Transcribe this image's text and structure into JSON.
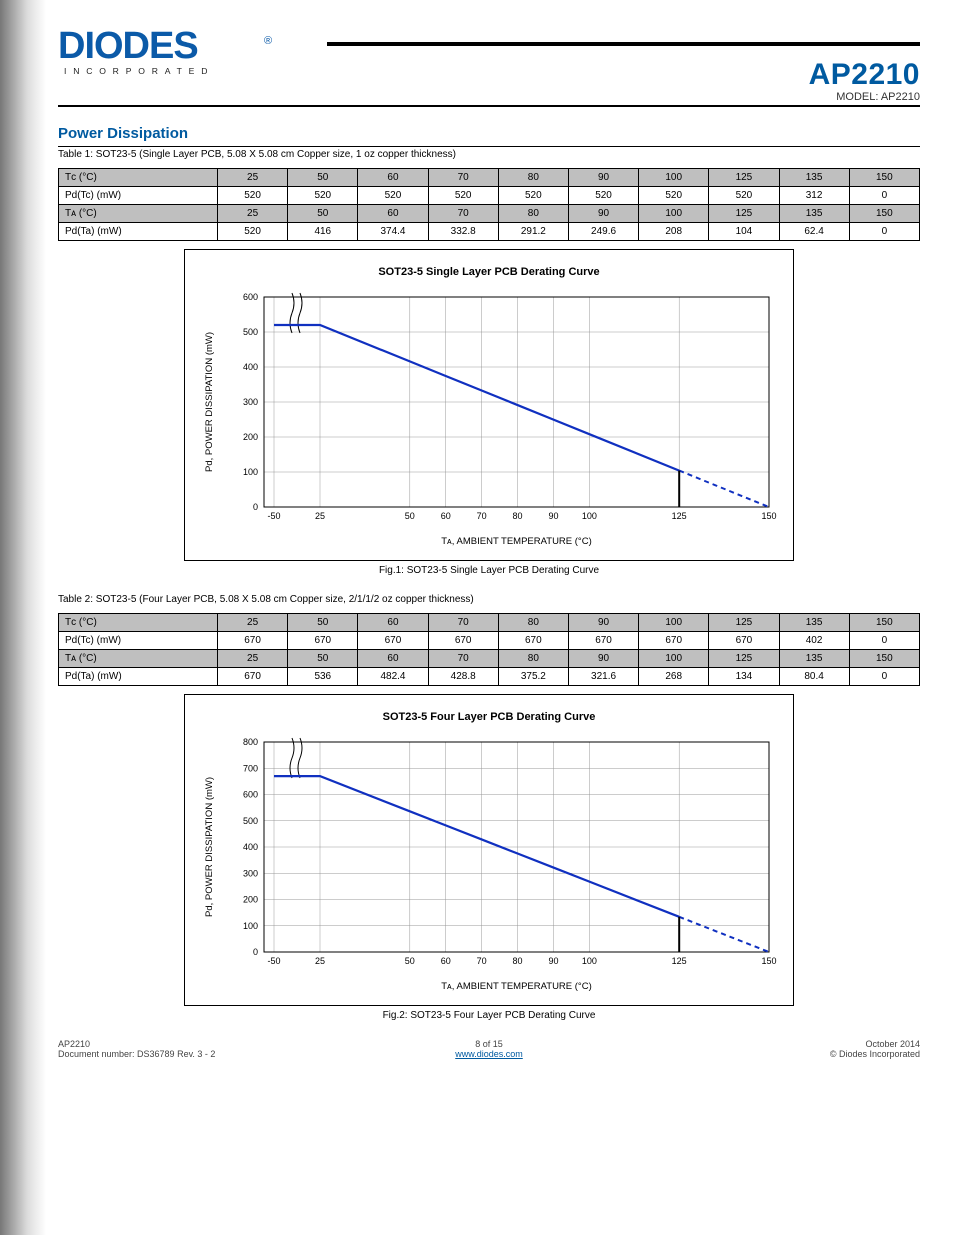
{
  "header": {
    "part_number": "AP2210",
    "model_line": "MODEL: AP2210"
  },
  "sections": {
    "power_title": "Power Dissipation",
    "section1": {
      "subnote": "Table 1: SOT23-5 (Single Layer PCB, 5.08 X 5.08 cm Copper size, 1 oz copper thickness)",
      "table": {
        "tc_row_label": "Tᴄ (°C)",
        "tc_values": [
          "25",
          "50",
          "60",
          "70",
          "80",
          "90",
          "100",
          "125",
          "135",
          "150"
        ],
        "pd_tc_row_label": "Pd(Tc) (mW)",
        "pd_tc_values": [
          "520",
          "520",
          "520",
          "520",
          "520",
          "520",
          "520",
          "520",
          "312",
          "0"
        ],
        "ta_row_label": "Tᴀ (°C)",
        "ta_values": [
          "25",
          "50",
          "60",
          "70",
          "80",
          "90",
          "100",
          "125",
          "135",
          "150"
        ],
        "pd_ta_row_label": "Pd(Ta) (mW)",
        "pd_ta_values": [
          "520",
          "416",
          "374.4",
          "332.8",
          "291.2",
          "249.6",
          "208",
          "104",
          "62.4",
          "0"
        ]
      },
      "chart_caption": "Fig.1: SOT23-5 Single Layer PCB Derating Curve"
    },
    "section2": {
      "subnote": "Table 2: SOT23-5 (Four Layer PCB, 5.08 X 5.08 cm Copper size, 2/1/1/2 oz copper thickness)",
      "table": {
        "tc_row_label": "Tᴄ (°C)",
        "tc_values": [
          "25",
          "50",
          "60",
          "70",
          "80",
          "90",
          "100",
          "125",
          "135",
          "150"
        ],
        "pd_tc_row_label": "Pd(Tc) (mW)",
        "pd_tc_values": [
          "670",
          "670",
          "670",
          "670",
          "670",
          "670",
          "670",
          "670",
          "402",
          "0"
        ],
        "ta_row_label": "Tᴀ (°C)",
        "ta_values": [
          "25",
          "50",
          "60",
          "70",
          "80",
          "90",
          "100",
          "125",
          "135",
          "150"
        ],
        "pd_ta_row_label": "Pd(Ta) (mW)",
        "pd_ta_values": [
          "670",
          "536",
          "482.4",
          "428.8",
          "375.2",
          "321.6",
          "268",
          "134",
          "80.4",
          "0"
        ]
      },
      "chart_caption": "Fig.2: SOT23-5 Four Layer PCB Derating Curve"
    }
  },
  "chart_data": [
    {
      "type": "line",
      "title": "SOT23-5 Single Layer PCB Derating Curve",
      "xlabel": "Tᴀ, AMBIENT TEMPERATURE (°C)",
      "ylabel": "Pd, POWER DISSIPATION (mW)",
      "ylim": [
        0,
        600
      ],
      "xlim": [
        -50,
        150
      ],
      "series": [
        {
          "name": "Pd",
          "x": [
            -50,
            25,
            50,
            60,
            70,
            80,
            90,
            100,
            125,
            135,
            150
          ],
          "y": [
            520,
            520,
            416,
            374.4,
            332.8,
            291.2,
            249.6,
            208,
            104,
            62.4,
            0
          ]
        }
      ],
      "xticks": [
        -50,
        25,
        50,
        60,
        70,
        80,
        90,
        100,
        125,
        150
      ],
      "yticks": [
        0,
        100,
        200,
        300,
        400,
        500,
        600
      ],
      "vertical_marker_x": 125
    },
    {
      "type": "line",
      "title": "SOT23-5 Four Layer PCB Derating Curve",
      "xlabel": "Tᴀ, AMBIENT TEMPERATURE (°C)",
      "ylabel": "Pd, POWER DISSIPATION (mW)",
      "ylim": [
        0,
        800
      ],
      "xlim": [
        -50,
        150
      ],
      "series": [
        {
          "name": "Pd",
          "x": [
            -50,
            25,
            50,
            60,
            70,
            80,
            90,
            100,
            125,
            135,
            150
          ],
          "y": [
            670,
            670,
            536,
            482.4,
            428.8,
            375.2,
            321.6,
            268,
            134,
            80.4,
            0
          ]
        }
      ],
      "xticks": [
        -50,
        25,
        50,
        60,
        70,
        80,
        90,
        100,
        125,
        150
      ],
      "yticks": [
        0,
        100,
        200,
        300,
        400,
        500,
        600,
        700,
        800
      ],
      "vertical_marker_x": 125
    }
  ],
  "footer": {
    "left_line1": "AP2210",
    "left_line2": "Document number: DS36789 Rev. 3 - 2",
    "center_line1": "8 of 15",
    "center_line2": "www.diodes.com",
    "right_line1": "October 2014",
    "right_line2": "© Diodes Incorporated"
  }
}
